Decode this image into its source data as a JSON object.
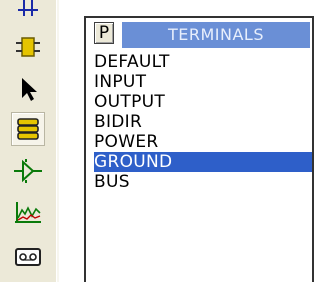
{
  "picker": {
    "button_label": "P",
    "title": "TERMINALS",
    "items": [
      {
        "label": "DEFAULT",
        "selected": false
      },
      {
        "label": "INPUT",
        "selected": false
      },
      {
        "label": "OUTPUT",
        "selected": false
      },
      {
        "label": "BIDIR",
        "selected": false
      },
      {
        "label": "POWER",
        "selected": false
      },
      {
        "label": "GROUND",
        "selected": true
      },
      {
        "label": "BUS",
        "selected": false
      }
    ]
  },
  "toolbar": {
    "tools": [
      {
        "icon": "junction-icon",
        "active": false
      },
      {
        "icon": "component-icon",
        "active": false
      },
      {
        "icon": "selection-arrow-icon",
        "active": false
      },
      {
        "icon": "terminals-icon",
        "active": true
      },
      {
        "icon": "device-pin-icon",
        "active": false
      },
      {
        "icon": "graph-icon",
        "active": false
      },
      {
        "icon": "tape-icon",
        "active": false
      }
    ]
  },
  "colors": {
    "toolbar_bg": "#ece9d8",
    "title_bg": "#6a8fd6",
    "title_text": "#e7eefc",
    "selection_bg": "#2e5fc9",
    "selection_text": "#ffffff"
  }
}
